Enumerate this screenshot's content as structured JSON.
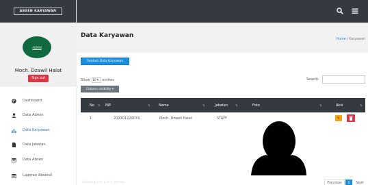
{
  "app": {
    "brand": "ABSEN KARYAWAN"
  },
  "sidebar": {
    "logo_text": "ADMIN",
    "user_name": "Moch. Dzawil Haiat",
    "signout_label": "Sign out",
    "items": [
      {
        "label": "Dashboard",
        "icon": "palette-icon"
      },
      {
        "label": "Data Admin",
        "icon": "user-icon"
      },
      {
        "label": "Data Karyawan",
        "icon": "bar-chart-icon",
        "active": true
      },
      {
        "label": "Data Jabatan",
        "icon": "file-icon"
      },
      {
        "label": "Data Absen",
        "icon": "calendar-icon"
      },
      {
        "label": "Laporan Absensi",
        "icon": "calendar-icon"
      }
    ]
  },
  "topbar": {
    "search_icon": "search-icon",
    "menu_icon": "menu-icon"
  },
  "page": {
    "title": "Data Karyawan",
    "breadcrumb_home": "Home",
    "breadcrumb_sep": "/",
    "breadcrumb_current": "Karyawan"
  },
  "toolbar": {
    "add_label": "Tambah Data Karyawan",
    "show_label": "Show",
    "entries_value": "10",
    "entries_label": "entries",
    "search_label": "Search:",
    "colvis_label": "Column visibility"
  },
  "table": {
    "columns": [
      "No",
      "NIP",
      "Nama",
      "Jabatan",
      "Foto",
      "Aksi"
    ],
    "rows": [
      {
        "no": "1",
        "nip": "202301220074",
        "nama": "Moch. Dzawil Haiat",
        "jabatan": "STAFF"
      }
    ]
  },
  "pagination": {
    "info": "Showing 1 to 1 of 1 entries",
    "previous": "Previous",
    "page": "1",
    "next": "Next"
  },
  "colors": {
    "dark": "#343a40",
    "primary": "#1a8fdd",
    "danger": "#dc3545",
    "warning": "#f3a712"
  }
}
